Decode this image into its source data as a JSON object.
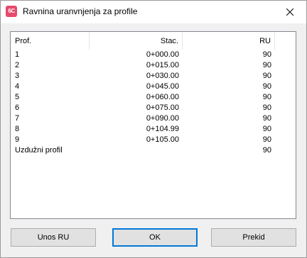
{
  "window": {
    "title": "Ravnina uranvnjenja za profile",
    "icon": "app-icon",
    "icon_text": "6C",
    "icon_color": "#e64a6c"
  },
  "list": {
    "columns": [
      "Prof.",
      "Stac.",
      "RU"
    ],
    "rows": [
      {
        "prof": "1",
        "stac": "0+000.00",
        "ru": "90"
      },
      {
        "prof": "2",
        "stac": "0+015.00",
        "ru": "90"
      },
      {
        "prof": "3",
        "stac": "0+030.00",
        "ru": "90"
      },
      {
        "prof": "4",
        "stac": "0+045.00",
        "ru": "90"
      },
      {
        "prof": "5",
        "stac": "0+060.00",
        "ru": "90"
      },
      {
        "prof": "6",
        "stac": "0+075.00",
        "ru": "90"
      },
      {
        "prof": "7",
        "stac": "0+090.00",
        "ru": "90"
      },
      {
        "prof": "8",
        "stac": "0+104.99",
        "ru": "90"
      },
      {
        "prof": "9",
        "stac": "0+105.00",
        "ru": "90"
      },
      {
        "prof": "Uzdužni profil",
        "stac": "",
        "ru": "90"
      }
    ]
  },
  "buttons": {
    "unos": "Unos RU",
    "ok": "OK",
    "prekid": "Prekid"
  },
  "colors": {
    "focus_border": "#0078d7",
    "button_bg": "#e1e1e1"
  }
}
